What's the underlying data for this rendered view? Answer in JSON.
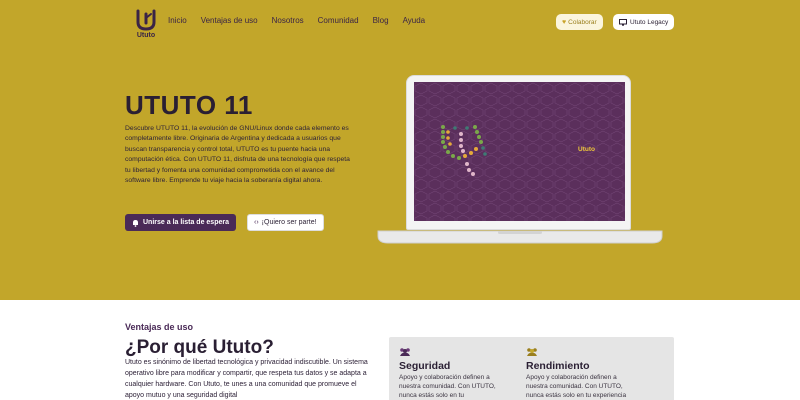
{
  "colors": {
    "hero_bg": "#c2a62a",
    "brand_purple": "#4a2a57",
    "screen_purple": "#5b2f5c",
    "accent_yellow": "#f0c93a"
  },
  "header": {
    "logo_text": "Ututo",
    "nav": [
      "Inicio",
      "Ventajas de uso",
      "Nosotros",
      "Comunidad",
      "Blog",
      "Ayuda"
    ],
    "colaborar_label": "Colaborar",
    "colaborar_icon": "heart-icon",
    "legacy_label": "Ututo Legacy",
    "legacy_icon": "monitor-icon"
  },
  "hero": {
    "title": "UTUTO 11",
    "description": "Descubre UTUTO 11, la evolución de GNU/Linux donde cada elemento es completamente libre. Originaria de Argentina y dedicada a usuarios que buscan transparencia y control total, UTUTO es tu puente hacia una computación ética. Con UTUTO 11, disfruta de una tecnología que respeta tu libertad y fomenta una comunidad comprometida con el avance del software libre. Emprende tu viaje hacia la soberanía digital ahora.",
    "primary_button": "Unirse a la lista de espera",
    "primary_icon": "bell-icon",
    "secondary_button": "¡Quiero ser parte!",
    "secondary_icon": "code-icon",
    "screen_label": "Ututo"
  },
  "advantages": {
    "label": "Ventajas de uso",
    "title": "¿Por qué Ututo?",
    "description": "Ututo es sinónimo de libertad tecnológica y privacidad indiscutible. Un sistema operativo libre para modificar y compartir, que respeta tus datos y se adapta a cualquier hardware. Con Ututo, te unes a una comunidad que promueve el apoyo mutuo y una seguridad digital",
    "cards": [
      {
        "icon": "people-icon",
        "title": "Seguridad",
        "text": "Apoyo y colaboración definen a nuestra comunidad. Con UTUTO, nunca estás solo en tu"
      },
      {
        "icon": "people-icon",
        "title": "Rendimiento",
        "text": "Apoyo y colaboración definen a nuestra comunidad. Con UTUTO, nunca estás solo en tu experiencia digital."
      }
    ]
  }
}
